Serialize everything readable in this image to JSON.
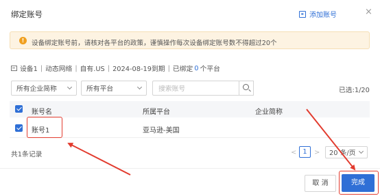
{
  "dialog": {
    "title": "绑定账号",
    "add_account_label": "添加账号",
    "close_glyph": "×"
  },
  "alert": {
    "icon_glyph": "!",
    "text": "设备绑定账号前，请核对各平台的政策，谨慎操作每次设备绑定账号数不得超过20个"
  },
  "device_info": {
    "device": "设备1",
    "network": "动态网络",
    "proxy": "自有.US",
    "expiry": "2024-08-19到期",
    "bound_prefix": "已绑定",
    "bound_count": "0",
    "bound_suffix": "个平台"
  },
  "filters": {
    "company": "所有企业简称",
    "platform": "所有平台",
    "search_placeholder": "搜索账号",
    "selected_count": "已选:1/20"
  },
  "table": {
    "headers": [
      "账号名",
      "所属平台",
      "企业简称"
    ],
    "rows": [
      {
        "account": "账号1",
        "platform": "亚马逊-美国",
        "company": "",
        "checked": true
      }
    ]
  },
  "pagination": {
    "total": "共1条记录",
    "prev_glyph": "<",
    "current_page": "1",
    "next_glyph": ">",
    "page_size": "20 条/页"
  },
  "footer": {
    "cancel_label": "取 消",
    "done_label": "完成"
  },
  "colors": {
    "accent": "#2f6fd6",
    "annotation_red": "#e23b2e",
    "alert_bg": "#fdf3e2",
    "alert_icon": "#f0a020"
  }
}
